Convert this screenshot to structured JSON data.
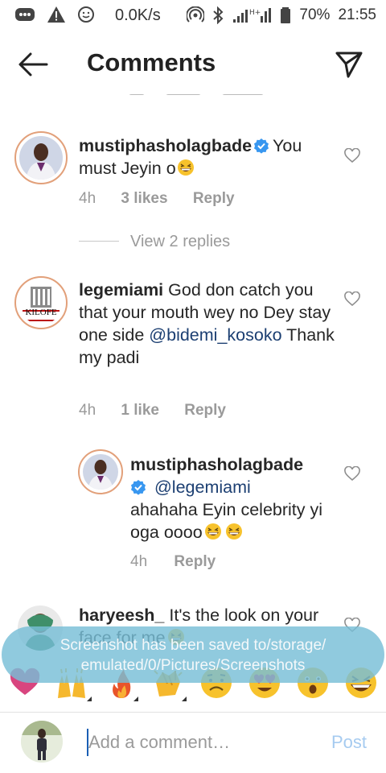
{
  "status_bar": {
    "speed": "0.0K/s",
    "battery": "70%",
    "time": "21:55"
  },
  "header": {
    "title": "Comments"
  },
  "comments": [
    {
      "username": "mustiphasholagbade",
      "verified": true,
      "text": "You must Jeyin o",
      "emoji": "grinning-squinting-face",
      "time": "4h",
      "likes": "3 likes",
      "reply_label": "Reply"
    },
    {
      "username": "legemiami",
      "verified": false,
      "avatar_label": "KILOFE",
      "text": "God don catch you that your mouth  wey no Dey stay one side",
      "mention": "@bidemi_kosoko",
      "text_after": "Thank my padi",
      "time": "4h",
      "likes": "1 like",
      "reply_label": "Reply"
    },
    {
      "username": "mustiphasholagbade",
      "verified": true,
      "mention": "@legemiami",
      "text": "ahahaha Eyin celebrity yi oga oooo",
      "emoji": "grinning-squinting-face x2",
      "time": "4h",
      "reply_label": "Reply"
    },
    {
      "username": "haryeesh_",
      "text": "It's the look on your face for me",
      "emoji": "grinning-squinting-face"
    }
  ],
  "view_replies": "View 2 replies",
  "toast": {
    "message": "Screenshot has been saved to/storage/ emulated/0/Pictures/Screenshots"
  },
  "reactions": [
    "heart",
    "raised-hands",
    "fire",
    "clapping-hands",
    "frowning-face",
    "heart-eyes-face",
    "astonished-face",
    "grinning-squinting-face"
  ],
  "composer": {
    "placeholder": "Add a comment…",
    "post_label": "Post"
  },
  "colors": {
    "accent": "#3897f0",
    "post_disabled": "#a6cbf0",
    "toast": "#78bed7",
    "mention": "#1c3f72",
    "meta_gray": "#9a9a9a"
  }
}
